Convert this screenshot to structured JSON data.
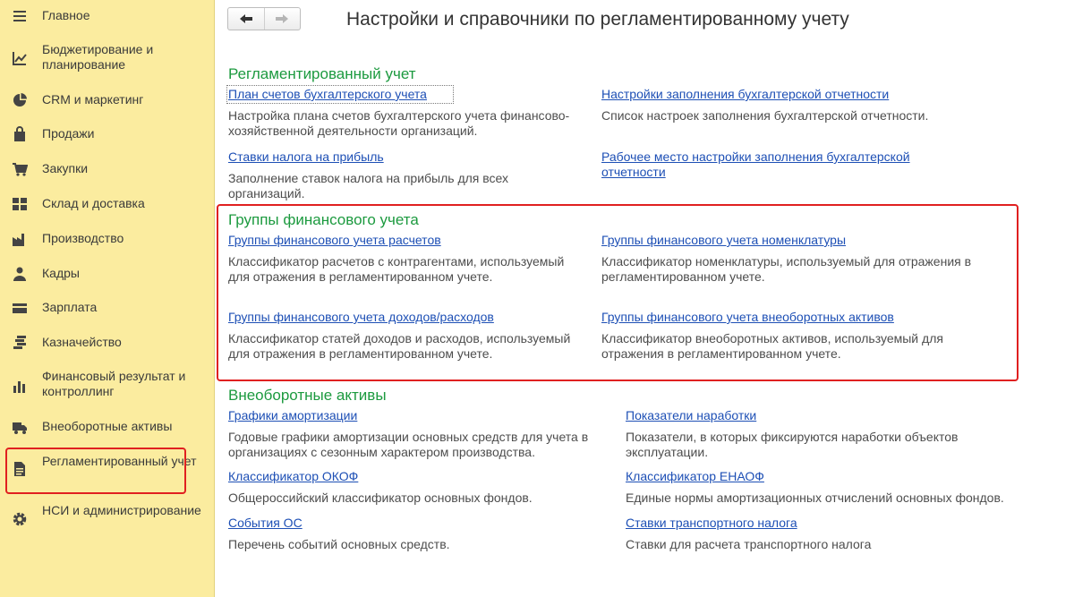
{
  "sidebar": {
    "items": [
      {
        "label": "Главное",
        "icon": "menu-lines-icon"
      },
      {
        "label": "Бюджетирование и планирование",
        "icon": "trend-chart-icon"
      },
      {
        "label": "CRM и маркетинг",
        "icon": "pie-chart-icon"
      },
      {
        "label": "Продажи",
        "icon": "shopping-bag-icon"
      },
      {
        "label": "Закупки",
        "icon": "shopping-cart-icon"
      },
      {
        "label": "Склад и доставка",
        "icon": "warehouse-grid-icon"
      },
      {
        "label": "Производство",
        "icon": "factory-icon"
      },
      {
        "label": "Кадры",
        "icon": "person-icon"
      },
      {
        "label": "Зарплата",
        "icon": "card-icon"
      },
      {
        "label": "Казначейство",
        "icon": "coins-icon"
      },
      {
        "label": "Финансовый результат и контроллинг",
        "icon": "bar-chart-icon"
      },
      {
        "label": "Внеоборотные активы",
        "icon": "truck-icon"
      },
      {
        "label": "Регламентированный учет",
        "icon": "document-icon"
      },
      {
        "label": "НСИ и администрирование",
        "icon": "gear-icon"
      }
    ],
    "active_index": 12
  },
  "header": {
    "title": "Настройки и справочники по регламентированному учету"
  },
  "sections": {
    "reg": {
      "title": "Регламентированный учет",
      "items": [
        {
          "link": "План счетов бухгалтерского учета",
          "desc": "Настройка плана счетов бухгалтерского учета финансово-хозяйственной деятельности организаций."
        },
        {
          "link": "Настройки заполнения бухгалтерской отчетности",
          "desc": "Список настроек заполнения бухгалтерской отчетности."
        },
        {
          "link": "Ставки налога на прибыль",
          "desc": "Заполнение ставок налога на прибыль для всех организаций."
        },
        {
          "link": "Рабочее место настройки заполнения бухгалтерской отчетности",
          "desc": ""
        }
      ]
    },
    "fin": {
      "title": "Группы финансового учета",
      "items": [
        {
          "link": "Группы финансового учета расчетов",
          "desc": "Классификатор расчетов с контрагентами, используемый для отражения в регламентированном учете."
        },
        {
          "link": "Группы финансового учета номенклатуры",
          "desc": "Классификатор номенклатуры, используемый для отражения в регламентированном учете."
        },
        {
          "link": "Группы финансового учета доходов/расходов",
          "desc": "Классификатор статей доходов и расходов, используемый для отражения в регламентированном учете."
        },
        {
          "link": "Группы финансового учета внеоборотных активов",
          "desc": "Классификатор внеоборотных активов, используемый для отражения в регламентированном учете."
        }
      ]
    },
    "assets": {
      "title": "Внеоборотные активы",
      "items": [
        {
          "link": "Графики амортизации",
          "desc": "Годовые графики амортизации основных средств для учета в организациях с сезонным характером производства."
        },
        {
          "link": "Показатели наработки",
          "desc": "Показатели, в которых фиксируются наработки объектов эксплуатации."
        },
        {
          "link": "Классификатор ОКОФ",
          "desc": "Общероссийский классификатор основных фондов."
        },
        {
          "link": "Классификатор ЕНАОФ",
          "desc": "Единые нормы амортизационных отчислений основных фондов."
        },
        {
          "link": "События ОС",
          "desc": "Перечень событий основных средств."
        },
        {
          "link": "Ставки транспортного налога",
          "desc": "Ставки для расчета транспортного налога"
        }
      ]
    }
  },
  "colors": {
    "sidebar_bg": "#fbec9f",
    "section_title": "#1c9a3f",
    "link": "#1d4fb5",
    "highlight": "#e02020"
  }
}
